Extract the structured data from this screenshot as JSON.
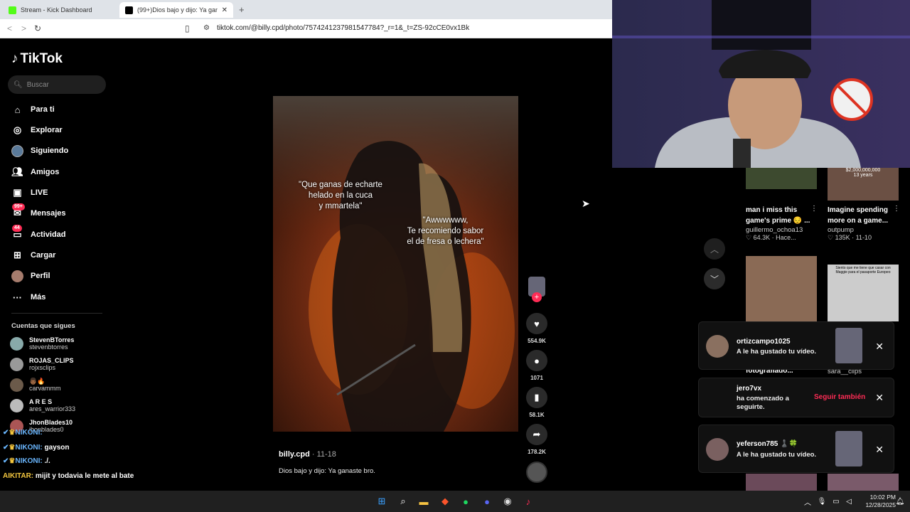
{
  "browser": {
    "tabs": [
      {
        "label": "Stream - Kick Dashboard"
      },
      {
        "label": "(99+)Dios bajo y dijo: Ya ganaste bro."
      }
    ],
    "new_tab": "+",
    "url": "tiktok.com/@billy.cpd/photo/7574241237981547784?_r=1&_t=ZS-92cCE0vx1Bk"
  },
  "tiktok": {
    "logo": "TikTok",
    "search_placeholder": "Buscar",
    "nav": [
      {
        "label": "Para ti",
        "icon": "home-icon"
      },
      {
        "label": "Explorar",
        "icon": "compass-icon"
      },
      {
        "label": "Siguiendo",
        "icon": "following-icon"
      },
      {
        "label": "Amigos",
        "icon": "friends-icon"
      },
      {
        "label": "LIVE",
        "icon": "live-icon"
      },
      {
        "label": "Mensajes",
        "icon": "messages-icon",
        "badge": "99+"
      },
      {
        "label": "Actividad",
        "icon": "activity-icon",
        "badge": "44"
      },
      {
        "label": "Cargar",
        "icon": "upload-icon"
      },
      {
        "label": "Perfil",
        "icon": "profile-icon"
      },
      {
        "label": "Más",
        "icon": "more-icon"
      }
    ],
    "following_title": "Cuentas que sigues",
    "following": [
      {
        "name": "StevenBTorres",
        "handle": "stevenbtorres"
      },
      {
        "name": "ROJAS_CLIPS",
        "handle": "rojxsclips"
      },
      {
        "name": "👨🏾🔥",
        "handle": "carvammm"
      },
      {
        "name": "A R E S",
        "handle": "ares_warrior333"
      },
      {
        "name": "JhonBlades10",
        "handle": "jhonblades0"
      }
    ]
  },
  "chat": [
    {
      "user": "NIKONI:",
      "text": "gayson"
    },
    {
      "user": "NIKONI:",
      "text": "./."
    },
    {
      "user": "AIKITAR:",
      "text": "mijit y todavia le mete al bate"
    }
  ],
  "post": {
    "caption_left": [
      "\"Que ganas de echarte",
      "helado en la cuca",
      "y mmartela\""
    ],
    "caption_right": [
      "\"Awwwwww,",
      "Te recomiendo sabor",
      "el de fresa o lechera\""
    ],
    "likes": "554.9K",
    "comments": "1071",
    "saves": "58.1K",
    "shares": "178.2K",
    "author": "billy.cpd",
    "date": " · 11-18",
    "description": "Dios bajo y dijo: Ya ganaste bro."
  },
  "related": [
    {
      "title1": "man i miss this",
      "title2": "game's prime 😔 ...",
      "user": "guillermo_ochoa13",
      "stat": "64.3K · Hace..."
    },
    {
      "title1": "Imagine spending",
      "title2": "more on a game...",
      "user": "outpump",
      "stat": "135K · 11-10"
    },
    {
      "title1": "fotografiado...",
      "user": "",
      "stat": ""
    },
    {
      "title1": "",
      "user": "sara__clips",
      "stat": ""
    }
  ],
  "related_thumb_text": {
    "age": "13 years",
    "money": "$2,000,000,000",
    "meme": "Siento que me tiene que casar con Maggie para el pasaporte Europeo"
  },
  "notifications": [
    {
      "user": "ortizcampo1025",
      "msg": "A le ha gustado tu vídeo."
    },
    {
      "user": "jero7vx",
      "msg": "ha comenzado a seguirte.",
      "action": "Seguir también"
    },
    {
      "user": "yeferson785 ♟️🍀",
      "msg": "A le ha gustado tu vídeo."
    }
  ],
  "taskbar": {
    "time": "10:02 PM",
    "date": "12/28/2025"
  },
  "colors": {
    "accent": "#fe2c55",
    "bg": "#000000",
    "chat_user": "#6ab7ff"
  }
}
